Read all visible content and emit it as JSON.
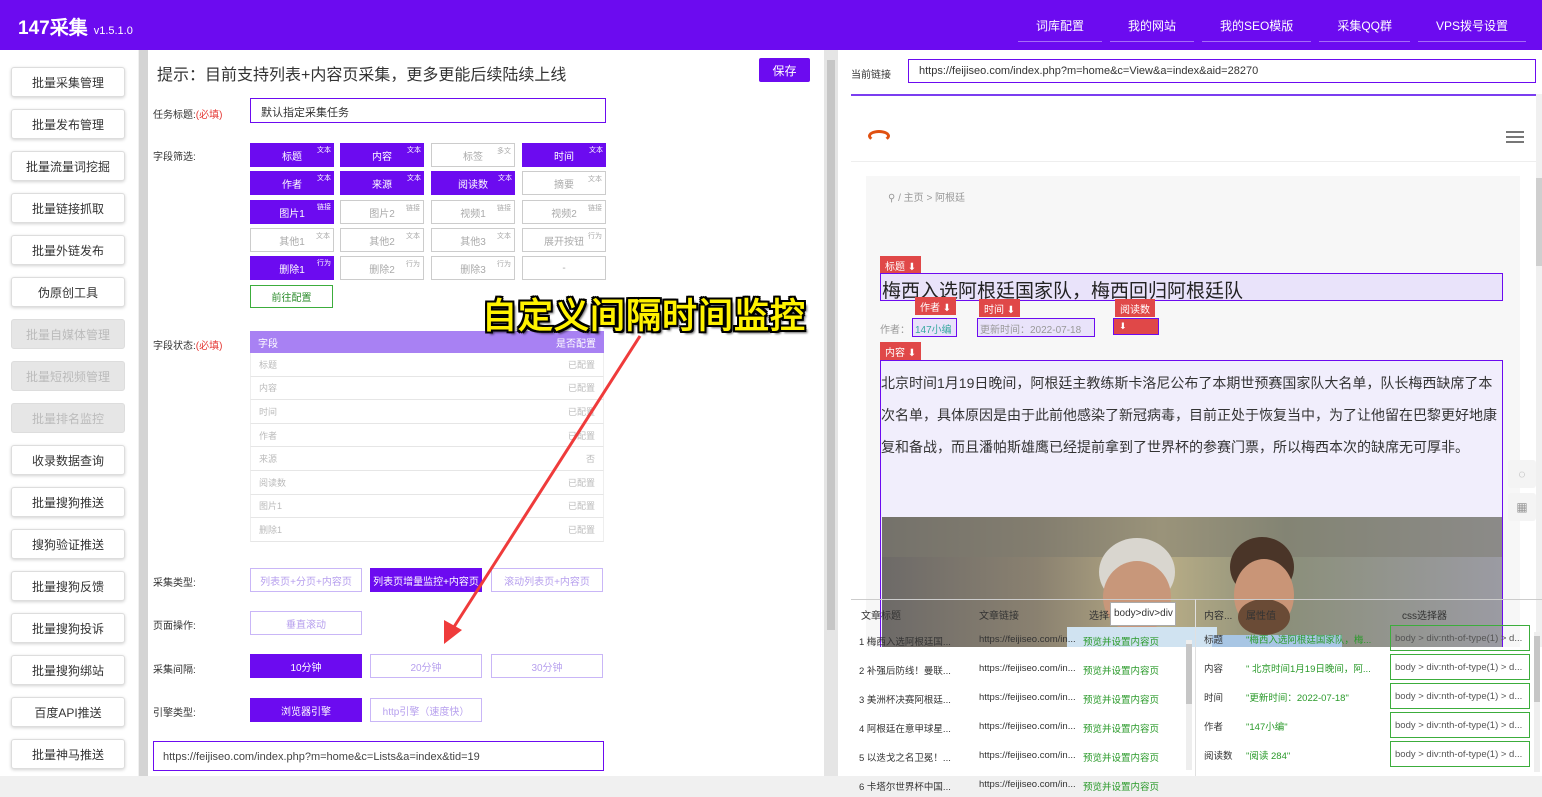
{
  "header": {
    "app_name": "147采集",
    "version": "v1.5.1.0",
    "nav": [
      "词库配置",
      "我的网站",
      "我的SEO模版",
      "采集QQ群",
      "VPS拨号设置"
    ]
  },
  "sidebar": {
    "items": [
      {
        "label": "批量采集管理",
        "disabled": false
      },
      {
        "label": "批量发布管理",
        "disabled": false
      },
      {
        "label": "批量流量词挖掘",
        "disabled": false
      },
      {
        "label": "批量链接抓取",
        "disabled": false
      },
      {
        "label": "批量外链发布",
        "disabled": false
      },
      {
        "label": "伪原创工具",
        "disabled": false
      },
      {
        "label": "批量自媒体管理",
        "disabled": true
      },
      {
        "label": "批量短视频管理",
        "disabled": true
      },
      {
        "label": "批量排名监控",
        "disabled": true
      },
      {
        "label": "收录数据查询",
        "disabled": false
      },
      {
        "label": "批量搜狗推送",
        "disabled": false
      },
      {
        "label": "搜狗验证推送",
        "disabled": false
      },
      {
        "label": "批量搜狗反馈",
        "disabled": false
      },
      {
        "label": "批量搜狗投诉",
        "disabled": false
      },
      {
        "label": "批量搜狗绑站",
        "disabled": false
      },
      {
        "label": "百度API推送",
        "disabled": false
      },
      {
        "label": "批量神马推送",
        "disabled": false
      }
    ]
  },
  "form": {
    "tip": "提示：目前支持列表+内容页采集，更多更能后续陆续上线",
    "save_label": "保存",
    "task_title_label": "任务标题:",
    "required_mark": "(必填)",
    "task_title_value": "默认指定采集任务",
    "field_filter_label": "字段筛选:",
    "fields": [
      {
        "label": "标题",
        "tag": "文本",
        "on": true
      },
      {
        "label": "内容",
        "tag": "文本",
        "on": true
      },
      {
        "label": "标签",
        "tag": "多文",
        "on": false
      },
      {
        "label": "时间",
        "tag": "文本",
        "on": true
      },
      {
        "label": "作者",
        "tag": "文本",
        "on": true
      },
      {
        "label": "来源",
        "tag": "文本",
        "on": true
      },
      {
        "label": "阅读数",
        "tag": "文本",
        "on": true
      },
      {
        "label": "摘要",
        "tag": "文本",
        "on": false
      },
      {
        "label": "图片1",
        "tag": "链接",
        "on": true
      },
      {
        "label": "图片2",
        "tag": "链接",
        "on": false
      },
      {
        "label": "视频1",
        "tag": "链接",
        "on": false
      },
      {
        "label": "视频2",
        "tag": "链接",
        "on": false
      },
      {
        "label": "其他1",
        "tag": "文本",
        "on": false
      },
      {
        "label": "其他2",
        "tag": "文本",
        "on": false
      },
      {
        "label": "其他3",
        "tag": "文本",
        "on": false
      },
      {
        "label": "展开按钮",
        "tag": "行为",
        "on": false
      },
      {
        "label": "删除1",
        "tag": "行为",
        "on": true
      },
      {
        "label": "删除2",
        "tag": "行为",
        "on": false
      },
      {
        "label": "删除3",
        "tag": "行为",
        "on": false
      },
      {
        "label": "-",
        "tag": "",
        "on": false
      }
    ],
    "goto_config_label": "前往配置",
    "field_status_label": "字段状态:",
    "status_header": {
      "field": "字段",
      "configured": "是否配置"
    },
    "status_rows": [
      {
        "field": "标题",
        "status": "已配置"
      },
      {
        "field": "内容",
        "status": "已配置"
      },
      {
        "field": "时间",
        "status": "已配置"
      },
      {
        "field": "作者",
        "status": "已配置"
      },
      {
        "field": "来源",
        "status": "否"
      },
      {
        "field": "阅读数",
        "status": "已配置"
      },
      {
        "field": "图片1",
        "status": "已配置"
      },
      {
        "field": "删除1",
        "status": "已配置"
      }
    ],
    "collect_type_label": "采集类型:",
    "collect_types": [
      {
        "label": "列表页+分页+内容页",
        "on": false
      },
      {
        "label": "列表页增量监控+内容页",
        "on": true
      },
      {
        "label": "滚动列表页+内容页",
        "on": false
      }
    ],
    "page_op_label": "页面操作:",
    "page_op_value": "垂直滚动",
    "interval_label": "采集间隔:",
    "intervals": [
      {
        "label": "10分钟",
        "on": true
      },
      {
        "label": "20分钟",
        "on": false
      },
      {
        "label": "30分钟",
        "on": false
      }
    ],
    "engine_label": "引擎类型:",
    "engines": [
      {
        "label": "浏览器引擎",
        "on": true
      },
      {
        "label": "http引擎（速度快）",
        "on": false
      }
    ],
    "list_url": "https://feijiseo.com/index.php?m=home&c=Lists&a=index&tid=19"
  },
  "annotation": "自定义间隔时间监控",
  "browser": {
    "current_link_label": "当前链接",
    "current_url": "https://feijiseo.com/index.php?m=home&c=View&a=index&aid=28270",
    "breadcrumb": "/ 主页 > 阿根廷",
    "tags": {
      "title": "标题 ⬇",
      "author": "作者 ⬇",
      "time": "时间 ⬇",
      "reads": "阅读数",
      "reads_arrow": "⬇",
      "content": "内容 ⬇"
    },
    "article_title": "梅西入选阿根廷国家队，梅西回归阿根廷队",
    "author_prefix": "作者：",
    "author": "147小编",
    "time": "更新时间：2022-07-18",
    "content": "北京时间1月19日晚间，阿根廷主教练斯卡洛尼公布了本期世预赛国家队大名单，队长梅西缺席了本次名单，具体原因是由于此前他感染了新冠病毒，目前正处于恢复当中，为了让他留在巴黎更好地康复和备战，而且潘帕斯雄鹰已经提前拿到了世界杯的参赛门票，所以梅西本次的缺席无可厚非。"
  },
  "bottom_left": {
    "headers": [
      "文章标题",
      "文章链接",
      "选择器"
    ],
    "tooltip": "body>div>div",
    "rows": [
      {
        "title": "1 梅西入选阿根廷国...",
        "link": "https://feijiseo.com/in...",
        "action": "预览并设置内容页"
      },
      {
        "title": "2 补强后防线！曼联...",
        "link": "https://feijiseo.com/in...",
        "action": "预览并设置内容页"
      },
      {
        "title": "3 美洲杯决赛阿根廷...",
        "link": "https://feijiseo.com/in...",
        "action": "预览并设置内容页"
      },
      {
        "title": "4 阿根廷在意甲球星...",
        "link": "https://feijiseo.com/in...",
        "action": "预览并设置内容页"
      },
      {
        "title": "5 以迭戈之名卫冕！...",
        "link": "https://feijiseo.com/in...",
        "action": "预览并设置内容页"
      },
      {
        "title": "6 卡塔尔世界杯中国...",
        "link": "https://feijiseo.com/in...",
        "action": "预览并设置内容页"
      }
    ]
  },
  "bottom_right": {
    "headers": [
      "内容...",
      "属性值",
      "css选择器"
    ],
    "rows": [
      {
        "key": "标题",
        "value": "\"梅西入选阿根廷国家队，梅...",
        "css": "body > div:nth-of-type(1) > d..."
      },
      {
        "key": "内容",
        "value": "\" 北京时间1月19日晚间，阿...",
        "css": "body > div:nth-of-type(1) > d..."
      },
      {
        "key": "时间",
        "value": "\"更新时间：2022-07-18\"",
        "css": "body > div:nth-of-type(1) > d..."
      },
      {
        "key": "作者",
        "value": "\"147小编\"",
        "css": "body > div:nth-of-type(1) > d..."
      },
      {
        "key": "阅读数",
        "value": "\"阅读 284\"",
        "css": "body > div:nth-of-type(1) > d..."
      }
    ]
  }
}
